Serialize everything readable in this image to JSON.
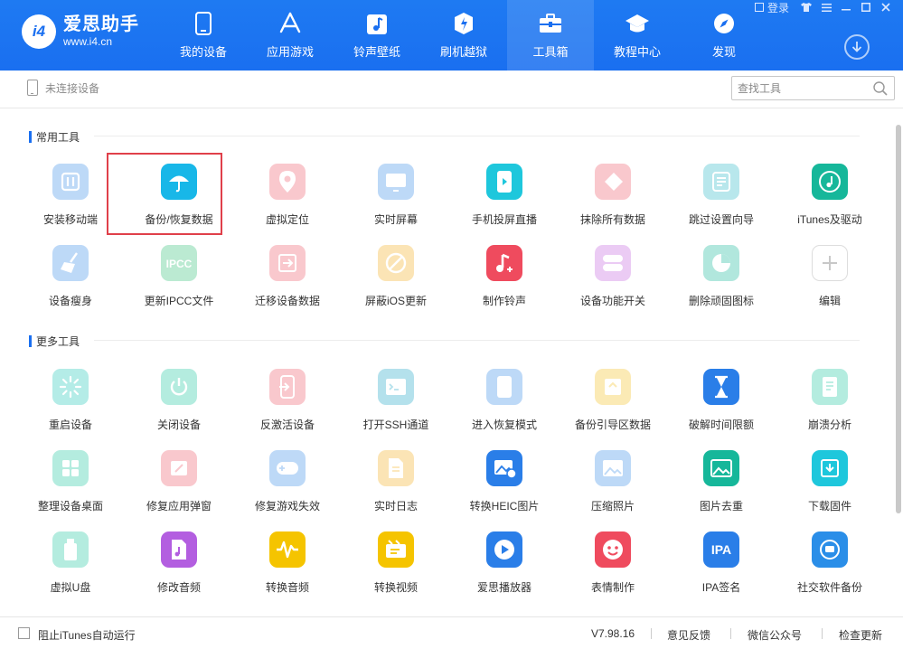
{
  "app": {
    "name": "爱思助手",
    "url": "www.i4.cn",
    "logo_badge": "i4"
  },
  "window": {
    "login_label": "登录"
  },
  "nav": [
    {
      "label": "我的设备",
      "icon": "phone-icon"
    },
    {
      "label": "应用游戏",
      "icon": "app-store-icon"
    },
    {
      "label": "铃声壁纸",
      "icon": "music-note-icon"
    },
    {
      "label": "刷机越狱",
      "icon": "flash-box-icon"
    },
    {
      "label": "工具箱",
      "icon": "toolbox-icon",
      "active": true
    },
    {
      "label": "教程中心",
      "icon": "graduation-cap-icon"
    },
    {
      "label": "发现",
      "icon": "compass-icon"
    }
  ],
  "subbar": {
    "device_status": "未连接设备",
    "search_placeholder": "查找工具"
  },
  "sections": {
    "common": {
      "title": "常用工具",
      "tools": [
        {
          "label": "安装移动端",
          "icon": "install-app-icon",
          "color": "#3a8de8",
          "faded": true
        },
        {
          "label": "备份/恢复数据",
          "icon": "umbrella-icon",
          "color": "#18b7e8",
          "faded": false,
          "highlight": true
        },
        {
          "label": "虚拟定位",
          "icon": "location-pin-icon",
          "color": "#ef5a6a",
          "faded": true
        },
        {
          "label": "实时屏幕",
          "icon": "screen-mirror-icon",
          "color": "#3a8de8",
          "faded": true
        },
        {
          "label": "手机投屏直播",
          "icon": "screen-cast-icon",
          "color": "#1ec7dc",
          "faded": false
        },
        {
          "label": "抹除所有数据",
          "icon": "eraser-icon",
          "color": "#ef5a6a",
          "faded": true
        },
        {
          "label": "跳过设置向导",
          "icon": "skip-guide-icon",
          "color": "#2cb7c8",
          "faded": true
        },
        {
          "label": "iTunes及驱动",
          "icon": "itunes-icon",
          "color": "#16b79a",
          "faded": false
        },
        {
          "label": "设备瘦身",
          "icon": "broom-icon",
          "color": "#3a8de8",
          "faded": true
        },
        {
          "label": "更新IPCC文件",
          "icon": "ipcc-icon",
          "color": "#34c079",
          "faded": true
        },
        {
          "label": "迁移设备数据",
          "icon": "migrate-icon",
          "color": "#ef5a6a",
          "faded": true
        },
        {
          "label": "屏蔽iOS更新",
          "icon": "block-update-icon",
          "color": "#f3b021",
          "faded": true
        },
        {
          "label": "制作铃声",
          "icon": "ringtone-icon",
          "color": "#ef4b5e",
          "faded": false
        },
        {
          "label": "设备功能开关",
          "icon": "toggle-switch-icon",
          "color": "#c565e0",
          "faded": true
        },
        {
          "label": "删除顽固图标",
          "icon": "delete-icon-icon",
          "color": "#16b79a",
          "faded": true
        },
        {
          "label": "编辑",
          "icon": "plus-icon",
          "color": "#cccccc",
          "faded": false,
          "outline": true
        }
      ]
    },
    "more": {
      "title": "更多工具",
      "tools": [
        {
          "label": "重启设备",
          "icon": "restart-icon",
          "color": "#1ec7b8",
          "faded": true
        },
        {
          "label": "关闭设备",
          "icon": "power-icon",
          "color": "#1ec7a0",
          "faded": true
        },
        {
          "label": "反激活设备",
          "icon": "deactivate-icon",
          "color": "#ef5a6a",
          "faded": true
        },
        {
          "label": "打开SSH通道",
          "icon": "terminal-icon",
          "color": "#1ea7c8",
          "faded": true
        },
        {
          "label": "进入恢复模式",
          "icon": "recovery-mode-icon",
          "color": "#3a8de8",
          "faded": true
        },
        {
          "label": "备份引导区数据",
          "icon": "boot-backup-icon",
          "color": "#f3c021",
          "faded": true
        },
        {
          "label": "破解时间限额",
          "icon": "hourglass-icon",
          "color": "#2a7ee8",
          "faded": false
        },
        {
          "label": "崩溃分析",
          "icon": "crash-log-icon",
          "color": "#1ec7a0",
          "faded": true
        },
        {
          "label": "整理设备桌面",
          "icon": "grid-desktop-icon",
          "color": "#1ec7a0",
          "faded": true
        },
        {
          "label": "修复应用弹窗",
          "icon": "fix-popup-icon",
          "color": "#ef5a6a",
          "faded": true
        },
        {
          "label": "修复游戏失效",
          "icon": "gamepad-icon",
          "color": "#3a8de8",
          "faded": true
        },
        {
          "label": "实时日志",
          "icon": "log-file-icon",
          "color": "#f3b021",
          "faded": true
        },
        {
          "label": "转换HEIC图片",
          "icon": "heic-convert-icon",
          "color": "#2a7ee8",
          "faded": false
        },
        {
          "label": "压缩照片",
          "icon": "photo-compress-icon",
          "color": "#3a8de8",
          "faded": true
        },
        {
          "label": "图片去重",
          "icon": "photo-dedupe-icon",
          "color": "#16b79a",
          "faded": false
        },
        {
          "label": "下载固件",
          "icon": "firmware-download-icon",
          "color": "#1ec7dc",
          "faded": false
        },
        {
          "label": "虚拟U盘",
          "icon": "usb-drive-icon",
          "color": "#1ec7a0",
          "faded": true
        },
        {
          "label": "修改音频",
          "icon": "audio-edit-icon",
          "color": "#b35ee0",
          "faded": false
        },
        {
          "label": "转换音频",
          "icon": "audio-wave-icon",
          "color": "#f5c400",
          "faded": false
        },
        {
          "label": "转换视频",
          "icon": "video-convert-icon",
          "color": "#f5c400",
          "faded": false
        },
        {
          "label": "爱思播放器",
          "icon": "play-button-icon",
          "color": "#2a7ee8",
          "faded": false
        },
        {
          "label": "表情制作",
          "icon": "emoji-icon",
          "color": "#ef4b5e",
          "faded": false
        },
        {
          "label": "IPA签名",
          "icon": "ipa-sign-icon",
          "color": "#2a7ee8",
          "faded": false,
          "text": "IPA"
        },
        {
          "label": "社交软件备份",
          "icon": "social-backup-icon",
          "color": "#2a8ee8",
          "faded": false
        }
      ]
    }
  },
  "footer": {
    "checkbox_label": "阻止iTunes自动运行",
    "version": "V7.98.16",
    "feedback": "意见反馈",
    "wechat": "微信公众号",
    "check_update": "检查更新"
  }
}
